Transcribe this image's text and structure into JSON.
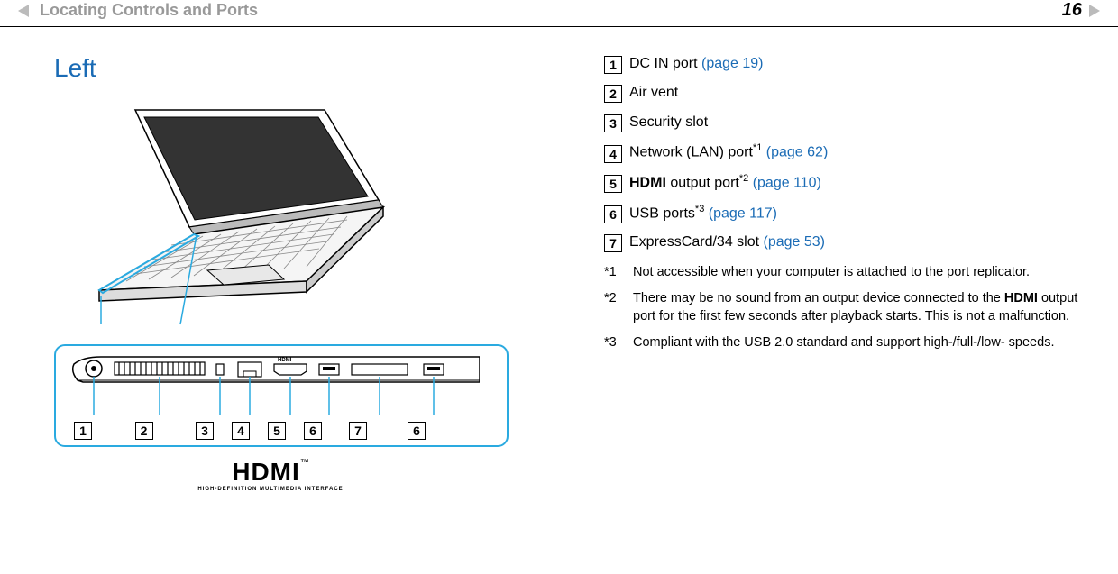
{
  "header": {
    "breadcrumb": "Locating Controls and Ports",
    "page_number": "16",
    "nav_text": "N n"
  },
  "section": {
    "title": "Left"
  },
  "callouts": [
    {
      "num": "1",
      "text": "DC IN port ",
      "link": "(page 19)"
    },
    {
      "num": "2",
      "text": "Air vent",
      "link": ""
    },
    {
      "num": "3",
      "text": "Security slot",
      "link": ""
    },
    {
      "num": "4",
      "text": "Network (LAN) port",
      "sup": "*1",
      "link": " (page 62)"
    },
    {
      "num": "5",
      "bold": "HDMI",
      "text": " output port",
      "sup": "*2",
      "link": " (page 110)"
    },
    {
      "num": "6",
      "text": "USB ports",
      "sup": "*3",
      "link": " (page 117)"
    },
    {
      "num": "7",
      "text": "ExpressCard/34 slot ",
      "link": "(page 53)"
    }
  ],
  "footnotes": [
    {
      "mark": "*1",
      "text": "Not accessible when your computer is attached to the port replicator."
    },
    {
      "mark": "*2",
      "text": "There may be no sound from an output device connected to the ",
      "bold": "HDMI",
      "text2": " output port for the first few seconds after playback starts. This is not a malfunction."
    },
    {
      "mark": "*3",
      "text": "Compliant with the USB 2.0 standard and support high-/full-/low- speeds."
    }
  ],
  "side_labels": [
    "1",
    "2",
    "3",
    "4",
    "5",
    "6",
    "7",
    "6"
  ],
  "hdmi": {
    "main": "HDMI",
    "tm": "™",
    "sub": "HIGH-DEFINITION MULTIMEDIA INTERFACE"
  }
}
